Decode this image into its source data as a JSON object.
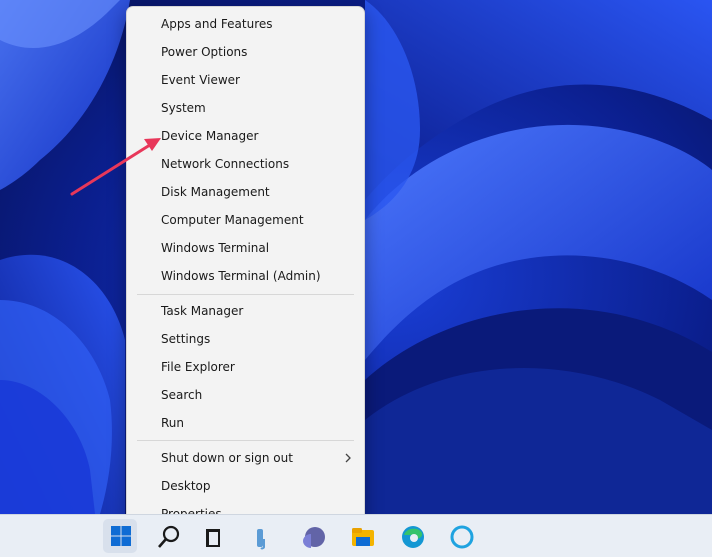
{
  "context_menu": {
    "groups": [
      [
        {
          "label": "Apps and Features"
        },
        {
          "label": "Power Options"
        },
        {
          "label": "Event Viewer"
        },
        {
          "label": "System"
        },
        {
          "label": "Device Manager"
        },
        {
          "label": "Network Connections"
        },
        {
          "label": "Disk Management"
        },
        {
          "label": "Computer Management"
        },
        {
          "label": "Windows Terminal"
        },
        {
          "label": "Windows Terminal (Admin)"
        }
      ],
      [
        {
          "label": "Task Manager"
        },
        {
          "label": "Settings"
        },
        {
          "label": "File Explorer"
        },
        {
          "label": "Search"
        },
        {
          "label": "Run"
        }
      ],
      [
        {
          "label": "Shut down or sign out",
          "submenu_icon": "chevron-right-icon"
        },
        {
          "label": "Desktop"
        },
        {
          "label": "Properties"
        }
      ]
    ],
    "highlighted_item": "Device Manager"
  },
  "taskbar": {
    "icons": [
      "windows-start-icon",
      "search-icon",
      "task-view-icon",
      "widgets-icon",
      "teams-chat-icon",
      "file-explorer-icon",
      "edge-browser-icon",
      "cortana-icon"
    ]
  },
  "annotation": {
    "color": "#e8375a",
    "points_to": "Device Manager"
  }
}
